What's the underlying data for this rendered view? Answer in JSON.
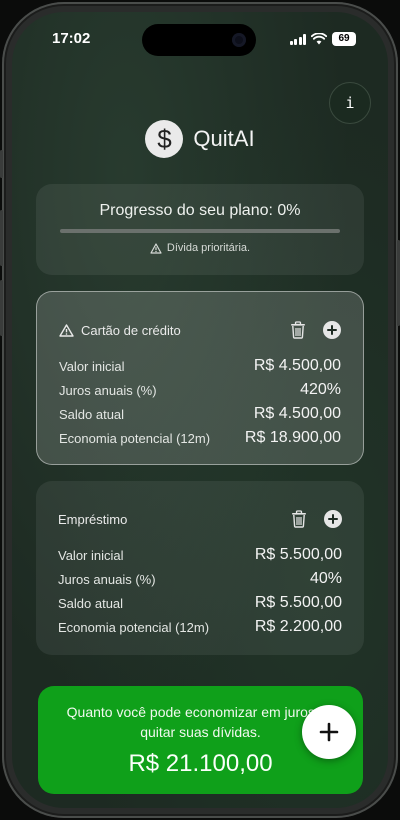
{
  "status_bar": {
    "time": "17:02",
    "battery": "69"
  },
  "app": {
    "title": "QuitAI",
    "logo_symbol": "$",
    "info_label": "i"
  },
  "progress": {
    "text": "Progresso do seu plano: 0%",
    "value": 0,
    "note": "Dívida prioritária."
  },
  "debts": [
    {
      "title": "Cartão de crédito",
      "priority": true,
      "rows": [
        {
          "label": "Valor inicial",
          "value": "R$ 4.500,00"
        },
        {
          "label": "Juros anuais (%)",
          "value": "420%"
        },
        {
          "label": "Saldo atual",
          "value": "R$ 4.500,00"
        },
        {
          "label": "Economia potencial (12m)",
          "value": "R$ 18.900,00"
        }
      ]
    },
    {
      "title": "Empréstimo",
      "priority": false,
      "rows": [
        {
          "label": "Valor inicial",
          "value": "R$ 5.500,00"
        },
        {
          "label": "Juros anuais (%)",
          "value": "40%"
        },
        {
          "label": "Saldo atual",
          "value": "R$ 5.500,00"
        },
        {
          "label": "Economia potencial (12m)",
          "value": "R$ 2.200,00"
        }
      ]
    }
  ],
  "savings": {
    "text": "Quanto você pode economizar em juros ao quitar suas dívidas.",
    "amount": "R$ 21.100,00"
  },
  "colors": {
    "accent_green": "#0fa01a",
    "background": "#1d2a22",
    "progress_track": "#6b716d"
  },
  "icons": {
    "logo": "dollar-icon",
    "warning": "warning-icon",
    "delete": "trash-icon",
    "add": "plus-icon",
    "fab": "plus-icon"
  }
}
